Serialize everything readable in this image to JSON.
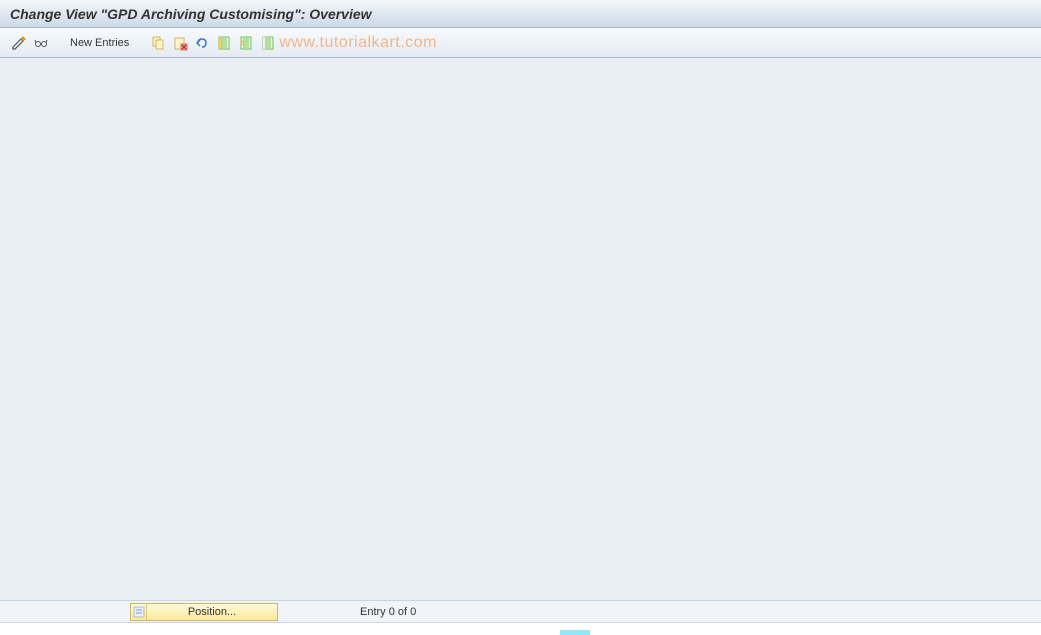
{
  "header": {
    "title": "Change View \"GPD Archiving Customising\": Overview"
  },
  "toolbar": {
    "new_entries_label": "New Entries"
  },
  "watermark": {
    "text": "www.tutorialkart.com"
  },
  "footer": {
    "position_label": "Position...",
    "entry_label": "Entry 0 of 0"
  }
}
